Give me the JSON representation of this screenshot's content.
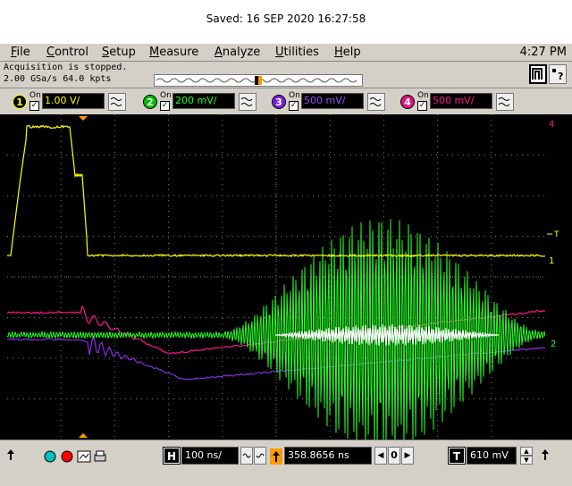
{
  "saved_text": "Saved:  16 SEP 2020  16:27:58",
  "menu": {
    "items": [
      {
        "first": "F",
        "rest": "ile"
      },
      {
        "first": "C",
        "rest": "ontrol"
      },
      {
        "first": "S",
        "rest": "etup"
      },
      {
        "first": "M",
        "rest": "easure"
      },
      {
        "first": "A",
        "rest": "nalyze"
      },
      {
        "first": "U",
        "rest": "tilities"
      },
      {
        "first": "H",
        "rest": "elp"
      }
    ],
    "clock": "4:27 PM"
  },
  "status": {
    "line1": "Acquisition is stopped.",
    "line2": "2.00 GSa/s   64.0 kpts",
    "help_glyph": "?"
  },
  "channels": [
    {
      "num": "1",
      "on": "On",
      "check": "✓",
      "value": "1.00 V/",
      "color": "#ffff00"
    },
    {
      "num": "2",
      "on": "On",
      "check": "✓",
      "value": "200 mV/",
      "color": "#00ff00"
    },
    {
      "num": "3",
      "on": "On",
      "check": "✓",
      "value": "500 mV/",
      "color": "#8a2be2"
    },
    {
      "num": "4",
      "on": "On",
      "check": "✓",
      "value": "500 mV/",
      "color": "#ff1493"
    }
  ],
  "markers": {
    "trigger_level": "T",
    "ch1": "1",
    "ch2": "2",
    "ch4": "4"
  },
  "bottom": {
    "h_label": "H",
    "timebase": "100 ns/",
    "position": "358.8656 ns",
    "t_label": "T",
    "trigger": "610 mV",
    "zero": "0",
    "left_arrow": "◀",
    "right_arrow": "▶"
  },
  "colors": {
    "ch1": "#ffff00",
    "ch2": "#22ff22",
    "ch3": "#8a2be2",
    "ch4": "#ff1493",
    "overlap": "#ffffff",
    "grid": "#7a7a7a",
    "panel": "#d4d0c8"
  }
}
